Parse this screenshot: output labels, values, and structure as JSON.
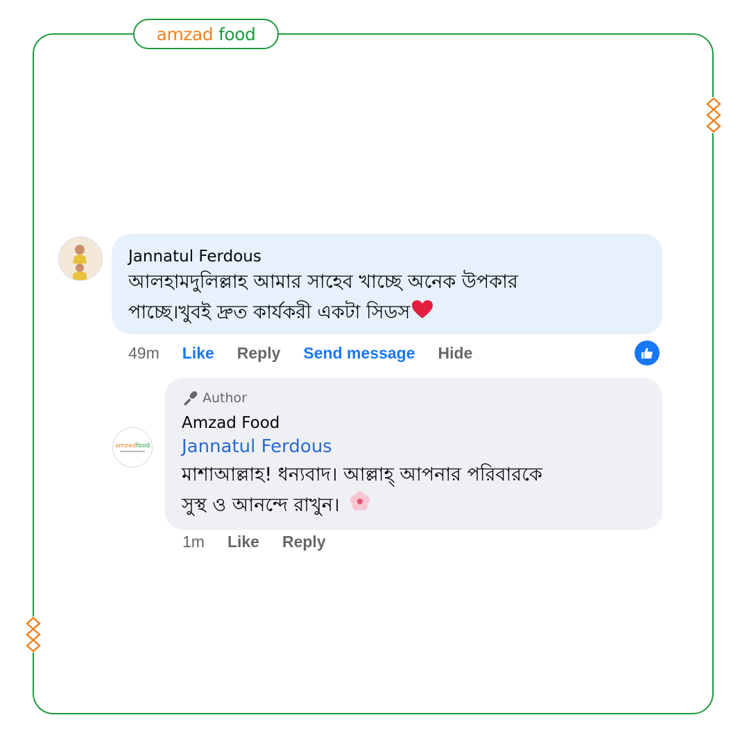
{
  "brand": {
    "logo_part1": "amzad",
    "logo_part2": "food"
  },
  "colors": {
    "frame_green": "#1e9a3c",
    "brand_orange": "#f0821e",
    "link_blue": "#1877f2",
    "mention_blue": "#2a6ad0"
  },
  "comment": {
    "author": "Jannatul Ferdous",
    "text_line1": "আলহামদুলিল্লাহ আমার সাহেব খাচ্ছে অনেক উপকার",
    "text_line2": "পাচ্ছে।খুবই দ্রুত কার্যকরী একটা সিডস",
    "emoji": "heart-emoji",
    "time": "49m",
    "actions": {
      "like": "Like",
      "reply": "Reply",
      "send_message": "Send message",
      "hide": "Hide"
    },
    "reaction": "like-icon"
  },
  "reply": {
    "badge": "Author",
    "author": "Amzad Food",
    "mention": "Jannatul Ferdous",
    "text_line1": "মাশাআল্লাহ! ধন্যবাদ। আল্লাহ্ আপনার পরিবারকে",
    "text_line2": "সুস্থ ও আনন্দে রাখুন।",
    "emoji": "cherry-blossom-emoji",
    "time": "1m",
    "actions": {
      "like": "Like",
      "reply": "Reply"
    }
  }
}
